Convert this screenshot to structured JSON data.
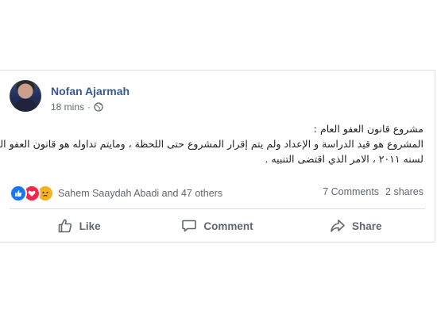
{
  "post": {
    "author": "Nofan Ajarmah",
    "time": "18 mins",
    "privacy_icon": "globe-icon",
    "text_lines": [
      "مشروع قانون العفو العام :",
      "المشروع هو قيد الدراسة و الإعداد ولم يتم إقرار المشروع حتى اللحظة ، ومايتم تداوله هو قانون العفو العام",
      "لسنه ٢٠١١ ، الامر الذي اقتضى التنبيه ."
    ]
  },
  "reactions": {
    "icons": [
      "like-reaction-icon",
      "love-reaction-icon",
      "sad-reaction-icon"
    ],
    "names": "Sahem Saaydah Abadi and 47 others",
    "comments": "7 Comments",
    "shares": "2 shares"
  },
  "actions": {
    "like": "Like",
    "comment": "Comment",
    "share": "Share"
  },
  "colors": {
    "author": "#385898",
    "secondary_text": "#606770",
    "like_blue": "#1877f2",
    "love_red": "#f0284a",
    "sad_yellow": "#f7b125",
    "border": "#dddfe2"
  }
}
